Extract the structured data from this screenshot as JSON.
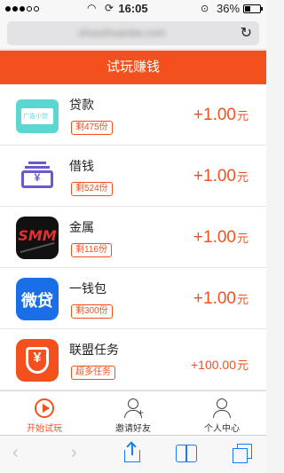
{
  "status_bar": {
    "time": "16:05",
    "battery": "36%",
    "signal_icon": "signal-dots-icon",
    "wifi_icon": "wifi-icon",
    "loading_icon": "loading-icon",
    "lock_icon": "rotation-lock-icon",
    "battery_level": 0.36
  },
  "url_bar": {
    "url": "shouzhuanba.com",
    "reload_icon": "reload-icon"
  },
  "header": {
    "title": "试玩赚钱"
  },
  "tasks": [
    {
      "name": "贷款",
      "badge": "剩475份",
      "reward": "+1.00",
      "unit": "元",
      "icon": "loan-app-icon",
      "icon_text": "广告小贷"
    },
    {
      "name": "借钱",
      "badge": "剩524份",
      "reward": "+1.00",
      "unit": "元",
      "icon": "borrow-money-icon"
    },
    {
      "name": "金属",
      "badge": "剩116份",
      "reward": "+1.00",
      "unit": "元",
      "icon": "metal-app-icon",
      "icon_text": "SMM"
    },
    {
      "name": "一钱包",
      "badge": "剩300份",
      "reward": "+1.00",
      "unit": "元",
      "icon": "wallet-app-icon",
      "icon_text": "微贷"
    },
    {
      "name": "联盟任务",
      "badge": "超多任务",
      "reward": "+100.00",
      "unit": "元",
      "icon": "alliance-task-icon",
      "icon_text": "¥"
    }
  ],
  "tab_bar": [
    {
      "label": "开始试玩",
      "icon": "play-icon",
      "active": true
    },
    {
      "label": "邀请好友",
      "icon": "add-friend-icon",
      "active": false
    },
    {
      "label": "个人中心",
      "icon": "person-icon",
      "active": false
    }
  ],
  "toolbar": {
    "back_icon": "back-arrow-icon",
    "forward_icon": "forward-arrow-icon",
    "share_icon": "share-icon",
    "bookmarks_icon": "bookmarks-icon",
    "tabs_icon": "tabs-icon"
  },
  "colors": {
    "accent": "#f4501e",
    "ios_blue": "#1a7cf0"
  }
}
